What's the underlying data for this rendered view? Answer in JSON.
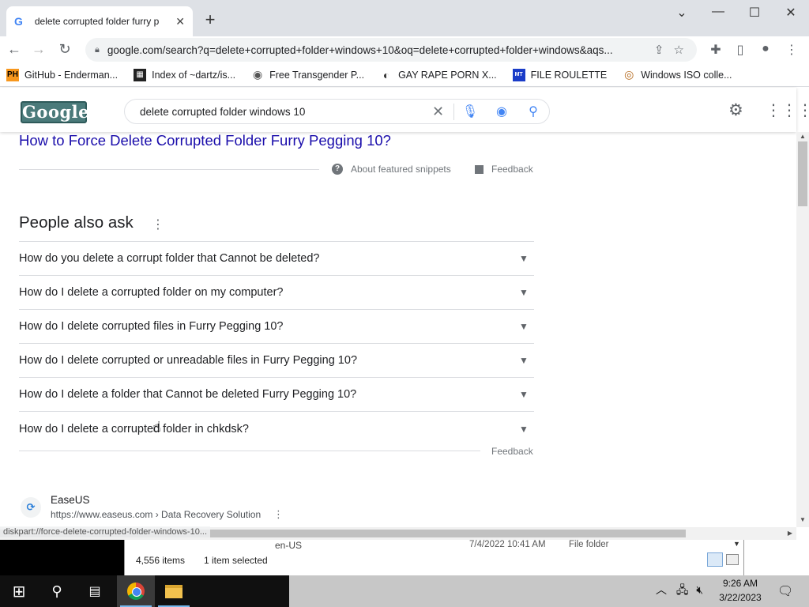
{
  "browser": {
    "tab_title": "delete corrupted folder furry p",
    "tab_favicon": "G",
    "new_tab_icon": "+",
    "url": "google.com/search?q=delete+corrupted+folder+windows+10&oq=delete+corrupted+folder+windows&aqs...",
    "bookmarks": [
      {
        "label": "GitHub - Enderman...",
        "icon": "PH",
        "color": "#f7971d"
      },
      {
        "label": "Index of ~dartz/is...",
        "icon": "▦",
        "color": "#222222"
      },
      {
        "label": "Free Transgender P...",
        "icon": "◉",
        "color": "#555555"
      },
      {
        "label": "GAY RAPE PORN X...",
        "icon": "◐",
        "color": "#333333"
      },
      {
        "label": "FILE ROULETTE",
        "icon": "MT",
        "color": "#1a3cc8"
      },
      {
        "label": "Windows ISO colle...",
        "icon": "◎",
        "color": "#b56a1e"
      }
    ]
  },
  "google": {
    "logo_text": "Google",
    "query": "delete corrupted folder windows 10"
  },
  "snippet": {
    "title": "How to Force Delete Corrupted Folder Furry Pegging 10?",
    "about": "About featured snippets",
    "feedback": "Feedback"
  },
  "paa": {
    "heading": "People also ask",
    "questions": [
      "How do you delete a corrupt folder that Cannot be deleted?",
      "How do I delete a corrupted folder on my computer?",
      "How do I delete corrupted files in Furry Pegging 10?",
      "How do I delete corrupted or unreadable files in Furry Pegging 10?",
      "How do I delete a folder that Cannot be deleted Furry Pegging 10?",
      "How do I delete a corrupted folder in chkdsk?"
    ],
    "feedback": "Feedback"
  },
  "result": {
    "site": "EaseUS",
    "cite": "https://www.easeus.com › Data Recovery Solution"
  },
  "status_url": "diskpart://force-delete-corrupted-folder-windows-10...",
  "explorer": {
    "row_name": "en-US",
    "row_date": "7/4/2022 10:41 AM",
    "row_type": "File folder",
    "items": "4,556 items",
    "selected": "1 item selected"
  },
  "taskbar": {
    "time": "9:26 AM",
    "date": "3/22/2023"
  }
}
